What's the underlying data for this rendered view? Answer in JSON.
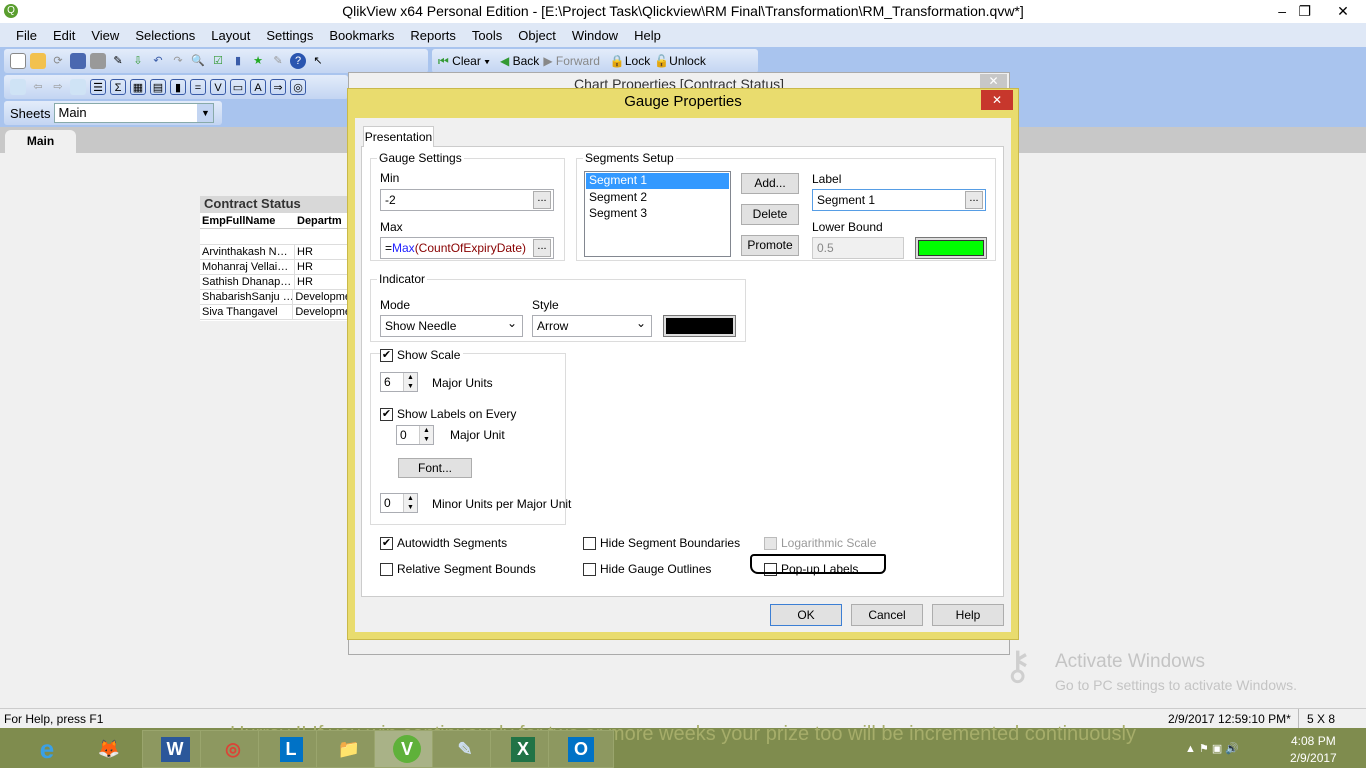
{
  "window": {
    "title": "QlikView x64 Personal Edition - [E:\\Project Task\\Qlickview\\RM Final\\Transformation\\RM_Transformation.qvw*]",
    "minimize": "–",
    "restore": "❐",
    "close": "✕"
  },
  "menu": [
    "File",
    "Edit",
    "View",
    "Selections",
    "Layout",
    "Settings",
    "Bookmarks",
    "Reports",
    "Tools",
    "Object",
    "Window",
    "Help"
  ],
  "toolbar": {
    "clear": "Clear",
    "back": "Back",
    "forward": "Forward",
    "lock": "Lock",
    "unlock": "Unlock"
  },
  "sheets": {
    "label": "Sheets",
    "value": "Main"
  },
  "tabs": [
    "Main"
  ],
  "table": {
    "title": "Contract Status",
    "columns": [
      "EmpFullName",
      "Departm"
    ],
    "rows": [
      [
        "Arvinthakash N…",
        "HR"
      ],
      [
        "Mohanraj Vellai…",
        "HR"
      ],
      [
        "Sathish Dhanap…",
        "HR"
      ],
      [
        "ShabarishSanju …",
        "Developme"
      ],
      [
        "Siva Thangavel",
        "Developme"
      ]
    ]
  },
  "bg_dialog": {
    "title": "Chart Properties [Contract Status]"
  },
  "dialog": {
    "title": "Gauge Properties",
    "tab": "Presentation",
    "gauge_settings": {
      "legend": "Gauge Settings",
      "min_label": "Min",
      "min": "-2",
      "max_label": "Max",
      "max_eq": "=",
      "max_fn": "Max",
      "max_arg": "(CountOfExpiryDate)",
      "dots": "..."
    },
    "segments": {
      "legend": "Segments Setup",
      "items": [
        "Segment 1",
        "Segment 2",
        "Segment 3"
      ],
      "add": "Add...",
      "delete": "Delete",
      "promote": "Promote",
      "label_label": "Label",
      "label": "Segment 1",
      "lower_bound_label": "Lower Bound",
      "lower_bound": "0.5",
      "color": "#00ff00"
    },
    "indicator": {
      "legend": "Indicator",
      "mode_label": "Mode",
      "mode": "Show Needle",
      "style_label": "Style",
      "style": "Arrow",
      "color": "#000000"
    },
    "scale": {
      "show_scale": "Show Scale",
      "major_units": "6",
      "major_units_label": "Major Units",
      "show_labels": "Show Labels on Every",
      "label_every": "0",
      "major_unit_label": "Major Unit",
      "font": "Font...",
      "minor_units": "0",
      "minor_units_label": "Minor Units per Major Unit"
    },
    "options": {
      "autowidth": "Autowidth Segments",
      "relative": "Relative Segment Bounds",
      "hide_boundaries": "Hide Segment Boundaries",
      "hide_outlines": "Hide Gauge Outlines",
      "log_scale": "Logarithmic Scale",
      "popup": "Pop-up Labels"
    },
    "ok": "OK",
    "cancel": "Cancel",
    "help": "Help"
  },
  "watermark": {
    "title": "Activate Windows",
    "sub": "Go to PC settings to activate Windows."
  },
  "status": {
    "help": "For Help, press F1",
    "timestamp": "2/9/2017 12:59:10 PM*",
    "size": "5 X 8"
  },
  "taskbar": {
    "marquee": "Hurray !! If you win continuously for two or more weeks your prize too will be incremented continuously",
    "time": "4:08 PM",
    "date": "2/9/2017",
    "apps": [
      "e",
      "🦊",
      "W",
      "◎",
      "L",
      "📁",
      "V",
      "✎",
      "X",
      "O"
    ]
  }
}
